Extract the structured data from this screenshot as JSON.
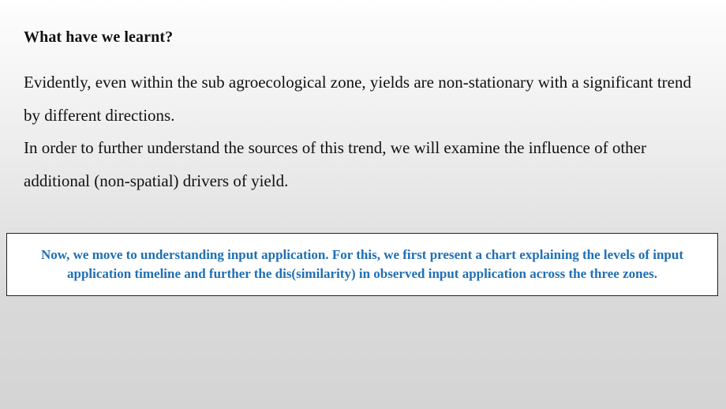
{
  "slide": {
    "heading": "What have we learnt?",
    "paragraphs": [
      "Evidently, even within the sub agroecological zone, yields are non-stationary with a significant trend by different directions.",
      "In order to further understand the sources of this trend, we will examine the influence of other additional (non-spatial) drivers of yield."
    ],
    "callout": {
      "text": "Now, we move to understanding input application. For this, we first present a chart explaining the levels of input application timeline and further the dis(similarity) in observed input application across the three zones.",
      "color": "#1f6fb5"
    }
  }
}
